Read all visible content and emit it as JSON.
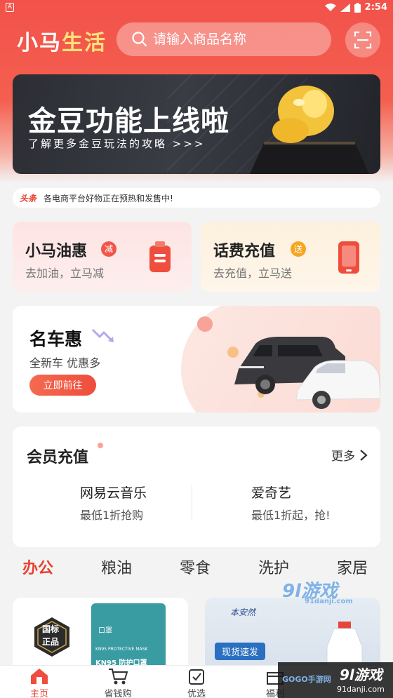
{
  "status_bar": {
    "time": "2:54",
    "left_icon": "A"
  },
  "header": {
    "app_title_part1": "小马",
    "app_title_part2": "生活",
    "search_placeholder": "请输入商品名称"
  },
  "banner": {
    "title": "金豆功能上线啦",
    "subtitle": "了解更多金豆玩法的攻略 >>>"
  },
  "news": {
    "tag": "头条",
    "text": "各电商平台好物正在预热和发售中!"
  },
  "feature_cards": [
    {
      "title": "小马油惠",
      "badge": "减",
      "subtitle": "去加油，立马减",
      "accent": "#f0564a"
    },
    {
      "title": "话费充值",
      "badge": "送",
      "subtitle": "去充值，立马送",
      "accent": "#f5a623"
    }
  ],
  "car_card": {
    "title": "名车惠",
    "subtitle": "全新车 优惠多",
    "button": "立即前往"
  },
  "member": {
    "title": "会员充值",
    "more": "更多",
    "items": [
      {
        "name": "网易云音乐",
        "desc": "最低1折抢购"
      },
      {
        "name": "爱奇艺",
        "desc": "最低1折起，抢!"
      }
    ]
  },
  "categories": [
    "办公",
    "粮油",
    "零食",
    "洗护",
    "家居"
  ],
  "products": {
    "left_badge_top": "国标",
    "left_badge_bottom": "正品",
    "left_pack_brand": "口罩",
    "left_pack_line1": "KN95 PROTECTIVE MASK",
    "left_pack_line2": "KN95 防护口罩",
    "right_brand": "本安然",
    "right_tag": "现货速发"
  },
  "bottom_nav": [
    {
      "label": "主页",
      "icon": "home-icon",
      "active": true
    },
    {
      "label": "省钱购",
      "icon": "cart-icon",
      "active": false
    },
    {
      "label": "优选",
      "icon": "bag-icon",
      "active": false
    },
    {
      "label": "福利",
      "icon": "gift-icon",
      "active": false
    }
  ],
  "watermarks": {
    "mid_logo": "9l游戏",
    "mid_url": "91danji.com",
    "bottom_logo": "9l游戏",
    "bottom_url": "91danji.com",
    "gogo": "GOGO手游网"
  },
  "colors": {
    "primary_red": "#f2524a",
    "accent_red": "#e8412f",
    "gold": "#f3c43b"
  }
}
